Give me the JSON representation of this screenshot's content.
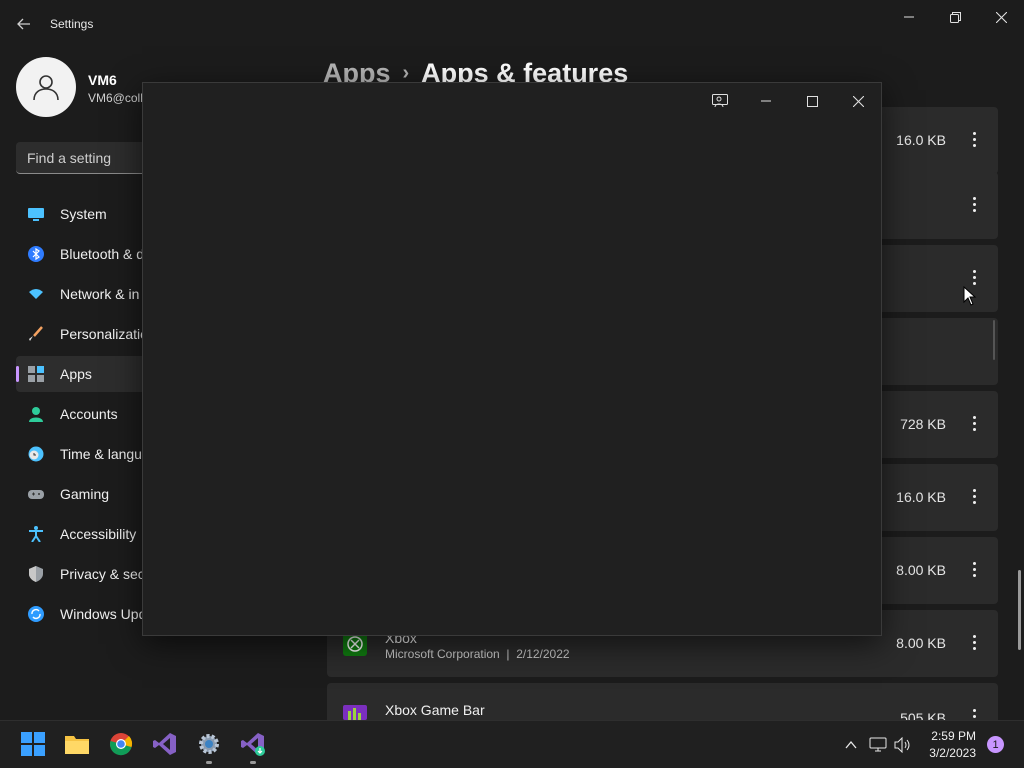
{
  "window": {
    "title": "Settings"
  },
  "profile": {
    "name": "VM6",
    "email": "VM6@coll"
  },
  "search": {
    "placeholder": "Find a setting"
  },
  "sidebar": {
    "items": [
      {
        "label": "System",
        "icon": "monitor-icon"
      },
      {
        "label": "Bluetooth & d",
        "icon": "bluetooth-icon"
      },
      {
        "label": "Network & in",
        "icon": "wifi-icon"
      },
      {
        "label": "Personalizatic",
        "icon": "brush-icon"
      },
      {
        "label": "Apps",
        "icon": "apps-icon",
        "active": true
      },
      {
        "label": "Accounts",
        "icon": "person-icon"
      },
      {
        "label": "Time & langu",
        "icon": "clock-globe-icon"
      },
      {
        "label": "Gaming",
        "icon": "gamepad-icon"
      },
      {
        "label": "Accessibility",
        "icon": "accessibility-icon"
      },
      {
        "label": "Privacy & secu",
        "icon": "shield-icon"
      },
      {
        "label": "Windows Upd",
        "icon": "update-icon"
      }
    ]
  },
  "header": {
    "parent": "Apps",
    "separator": "›",
    "current": "Apps & features"
  },
  "apps": [
    {
      "size": "16.0 KB"
    },
    {
      "size": ""
    },
    {
      "size": ""
    },
    {
      "size": ""
    },
    {
      "size": "728 KB"
    },
    {
      "size": "16.0 KB"
    },
    {
      "size": "8.00 KB"
    },
    {
      "name": "Xbox",
      "publisher": "Microsoft Corporation",
      "date": "2/12/2022",
      "size": "8.00 KB",
      "icon": "xbox-icon"
    },
    {
      "name": "Xbox Game Bar",
      "size": "505 KB",
      "icon": "xbox-game-bar-icon"
    }
  ],
  "meta_separator": "|",
  "taskbar": {
    "time": "2:59 PM",
    "date": "3/2/2023",
    "notification_count": "1"
  },
  "colors": {
    "accent": "#c896ff",
    "background": "#1c1c1c",
    "card": "#2b2b2b"
  }
}
